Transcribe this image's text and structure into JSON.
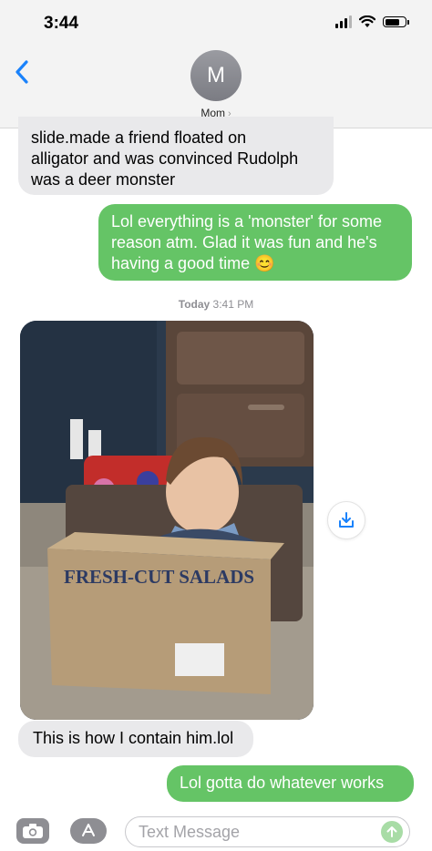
{
  "status_bar": {
    "time": "3:44"
  },
  "header": {
    "avatar_initial": "M",
    "contact_name": "Mom",
    "contact_chevron": "›"
  },
  "messages": [
    {
      "direction": "incoming",
      "lines": [
        "slide.made a friend floated on",
        "alligator  and was convinced Rudolph",
        "was a deer monster"
      ]
    },
    {
      "direction": "outgoing",
      "lines": [
        "Lol everything is a 'monster' for some",
        "reason atm. Glad it was fun and he's",
        "having a good time 😊"
      ]
    },
    {
      "type": "timestamp",
      "day": "Today",
      "time": "3:41 PM"
    },
    {
      "direction": "incoming",
      "type": "photo",
      "box_text": "FRESH-CUT SALADS"
    },
    {
      "direction": "incoming",
      "text": "This is how I contain him.lol"
    },
    {
      "direction": "outgoing",
      "text": "Lol gotta do whatever works"
    }
  ],
  "input": {
    "placeholder": "Text Message"
  },
  "icons": {
    "back": "chevron-left-icon",
    "camera": "camera-icon",
    "apps": "app-store-icon",
    "save": "download-icon",
    "send": "arrow-up-icon"
  },
  "colors": {
    "outgoing": "#65c466",
    "incoming": "#e9e9eb",
    "accent": "#1a82fb"
  }
}
